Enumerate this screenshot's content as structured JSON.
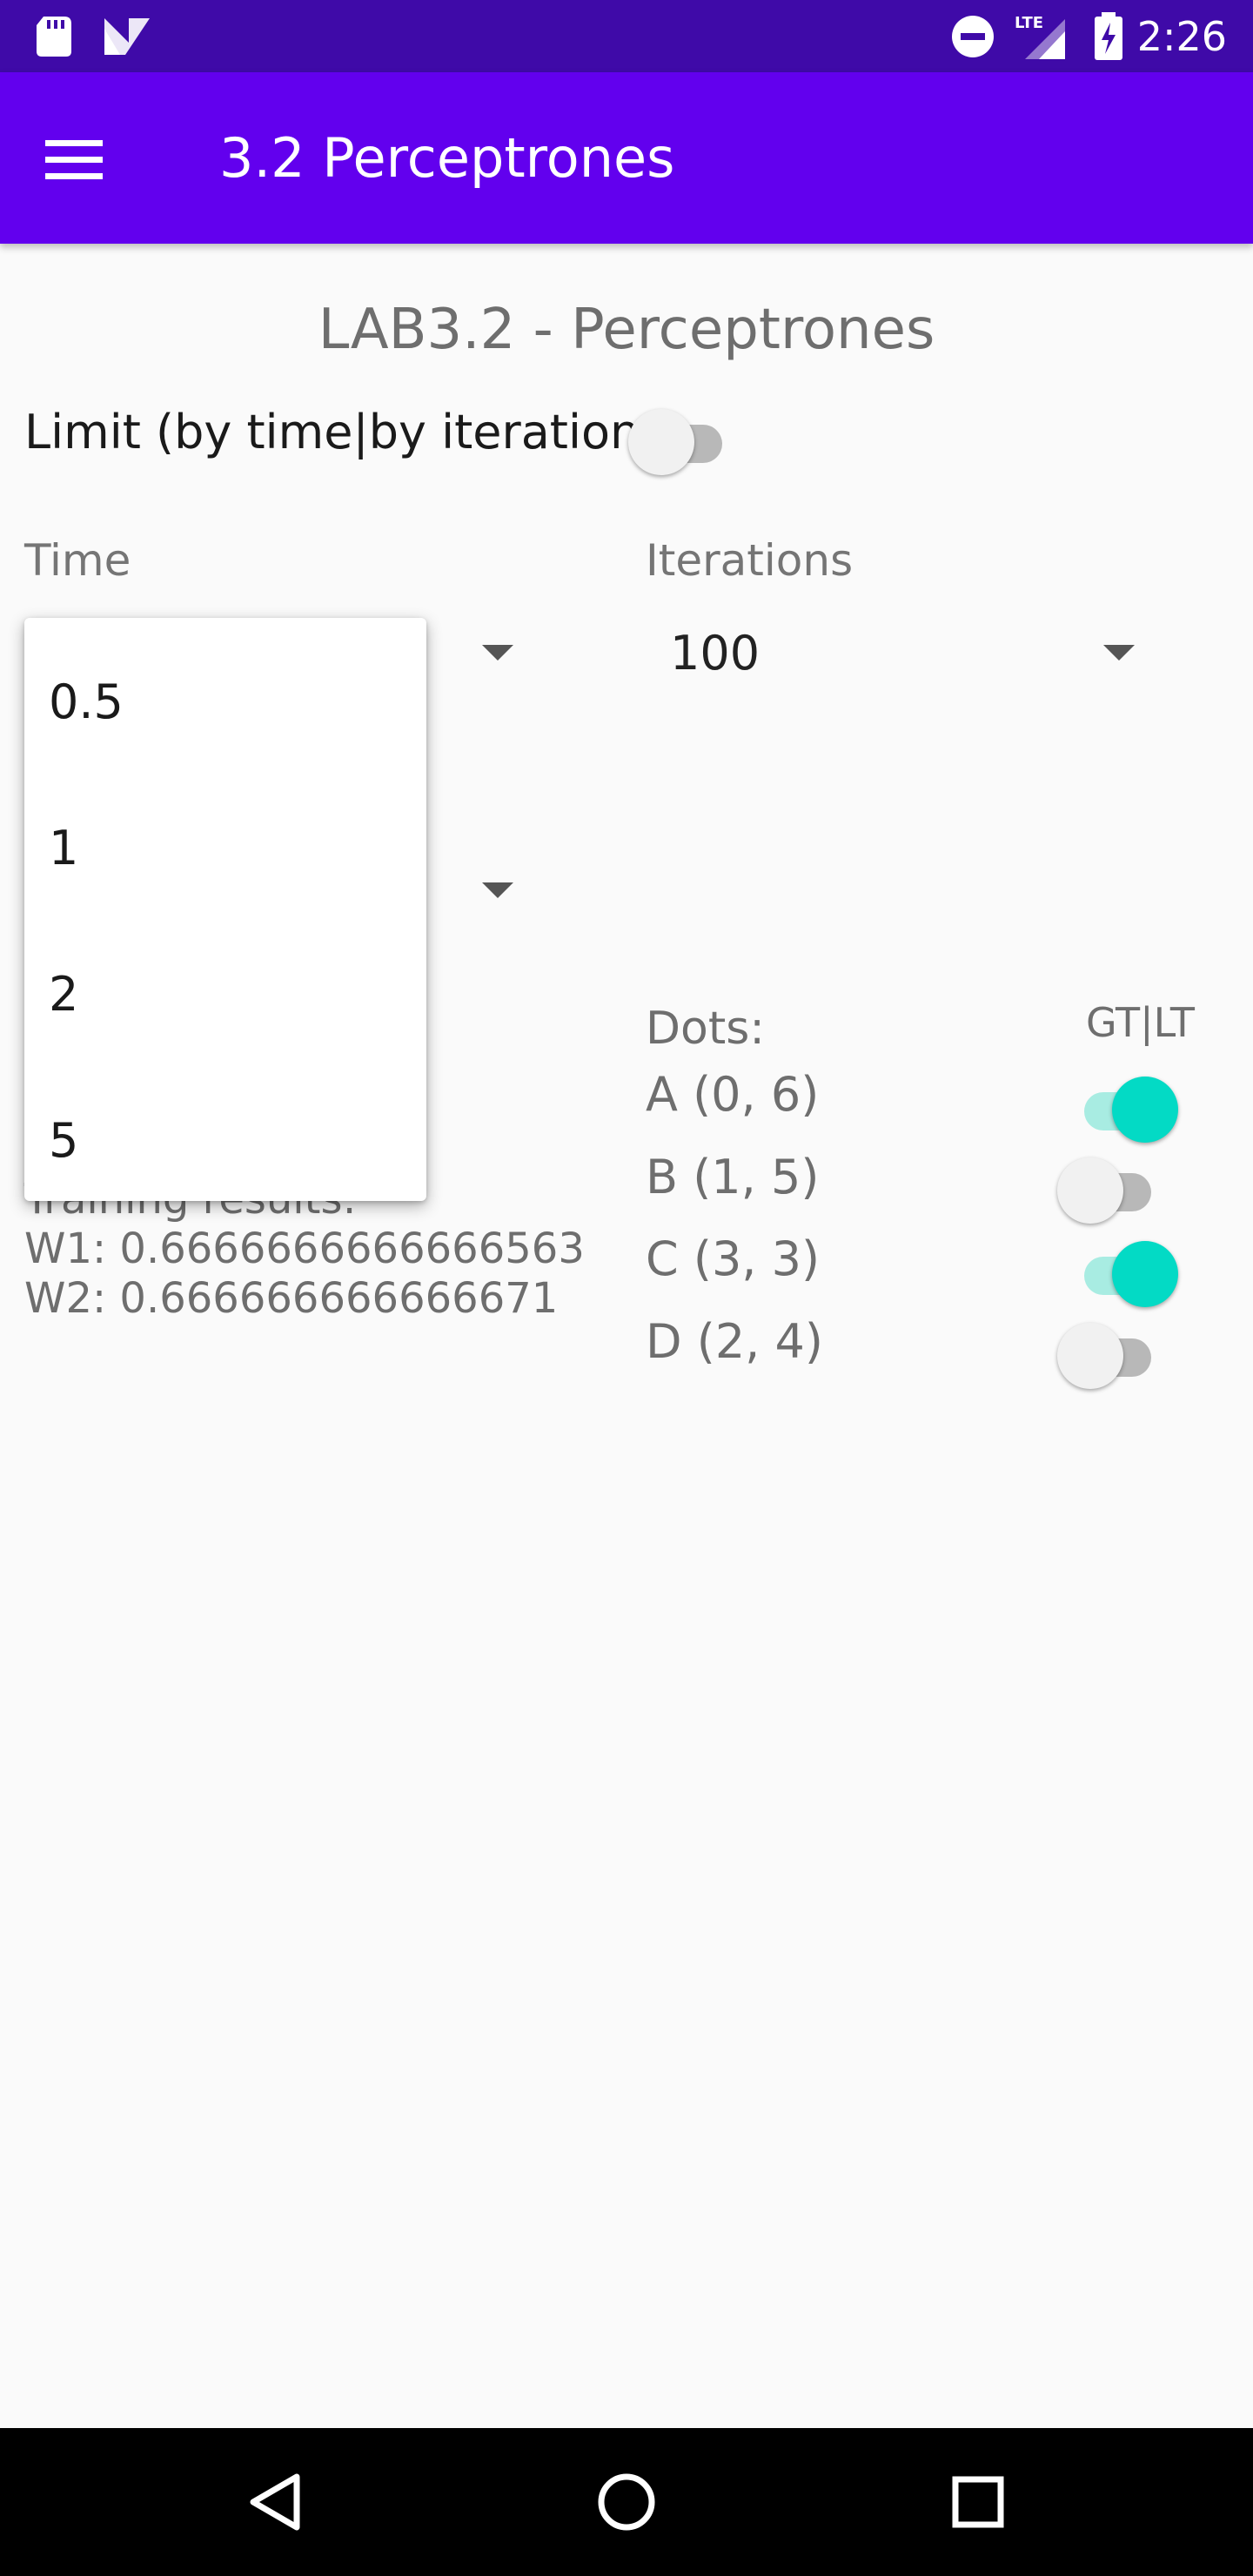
{
  "status_bar": {
    "time": "2:26",
    "network": "LTE",
    "icons": [
      "sd-card-icon",
      "n-logo-icon",
      "do-not-disturb-icon",
      "lte-signal-icon",
      "battery-charging-icon"
    ]
  },
  "app_bar": {
    "title": "3.2 Perceptrones",
    "menu_icon": "hamburger-menu-icon",
    "color": "#6200ee"
  },
  "main": {
    "screen_title": "LAB3.2 - Perceptrones",
    "limit_label": "Limit (by time|by iterations)",
    "limit_switch_on": false,
    "time_label": "Time",
    "iterations_label": "Iterations",
    "iterations_value": "100",
    "training_results_label": "Training results:",
    "w1": "W1: 0.6666666666666563",
    "w2": "W2: 0.666666666666671",
    "dots_label": "Dots:",
    "gtlt_label": "GT|LT",
    "dots": [
      {
        "label": "A (0, 6)",
        "on": true
      },
      {
        "label": "B (1, 5)",
        "on": false
      },
      {
        "label": "C (3, 3)",
        "on": true
      },
      {
        "label": "D (2, 4)",
        "on": false
      }
    ],
    "accent_color": "#03dac5"
  },
  "time_dropdown": {
    "options": [
      "0.5",
      "1",
      "2",
      "5"
    ]
  },
  "nav_bar": {
    "buttons": [
      "back-icon",
      "home-icon",
      "recents-icon"
    ]
  }
}
